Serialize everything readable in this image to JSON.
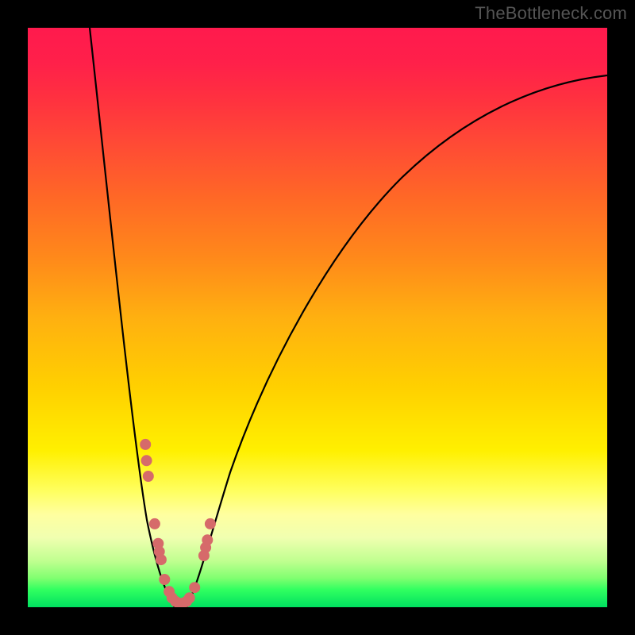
{
  "watermark": "TheBottleneck.com",
  "colors": {
    "background": "#000000",
    "gradient_top": "#ff1a4d",
    "gradient_mid": "#ffd000",
    "gradient_bottom": "#00e060",
    "curve": "#000000",
    "marker": "#d66a6a"
  },
  "chart_data": {
    "type": "line",
    "title": "",
    "xlabel": "",
    "ylabel": "",
    "xlim": [
      0,
      100
    ],
    "ylim": [
      0,
      100
    ],
    "curve_left": {
      "x": [
        10.7,
        13.7,
        17.8,
        20.5,
        23.6,
        25.3
      ],
      "y": [
        100,
        72.6,
        45.2,
        15.1,
        2.7,
        0
      ]
    },
    "curve_right": {
      "x": [
        27.4,
        31.5,
        34.9,
        41.1,
        51.4,
        64.4,
        75.3,
        87.7,
        100
      ],
      "y": [
        0,
        4.1,
        12.3,
        23.3,
        41.1,
        60.3,
        73.9,
        84.9,
        91.8
      ]
    },
    "marker_points": [
      {
        "x": 20.3,
        "y": 28.1
      },
      {
        "x": 20.5,
        "y": 25.3
      },
      {
        "x": 20.8,
        "y": 22.6
      },
      {
        "x": 21.9,
        "y": 14.4
      },
      {
        "x": 22.5,
        "y": 11.0
      },
      {
        "x": 22.7,
        "y": 9.6
      },
      {
        "x": 23.0,
        "y": 8.2
      },
      {
        "x": 23.6,
        "y": 4.8
      },
      {
        "x": 24.4,
        "y": 2.7
      },
      {
        "x": 24.9,
        "y": 1.6
      },
      {
        "x": 25.5,
        "y": 1.0
      },
      {
        "x": 26.0,
        "y": 0.7
      },
      {
        "x": 26.8,
        "y": 0.7
      },
      {
        "x": 27.4,
        "y": 1.0
      },
      {
        "x": 27.9,
        "y": 1.6
      },
      {
        "x": 28.8,
        "y": 3.4
      },
      {
        "x": 30.4,
        "y": 8.9
      },
      {
        "x": 30.7,
        "y": 10.3
      },
      {
        "x": 31.0,
        "y": 11.6
      },
      {
        "x": 31.5,
        "y": 14.4
      }
    ],
    "marker_radius": 7
  }
}
